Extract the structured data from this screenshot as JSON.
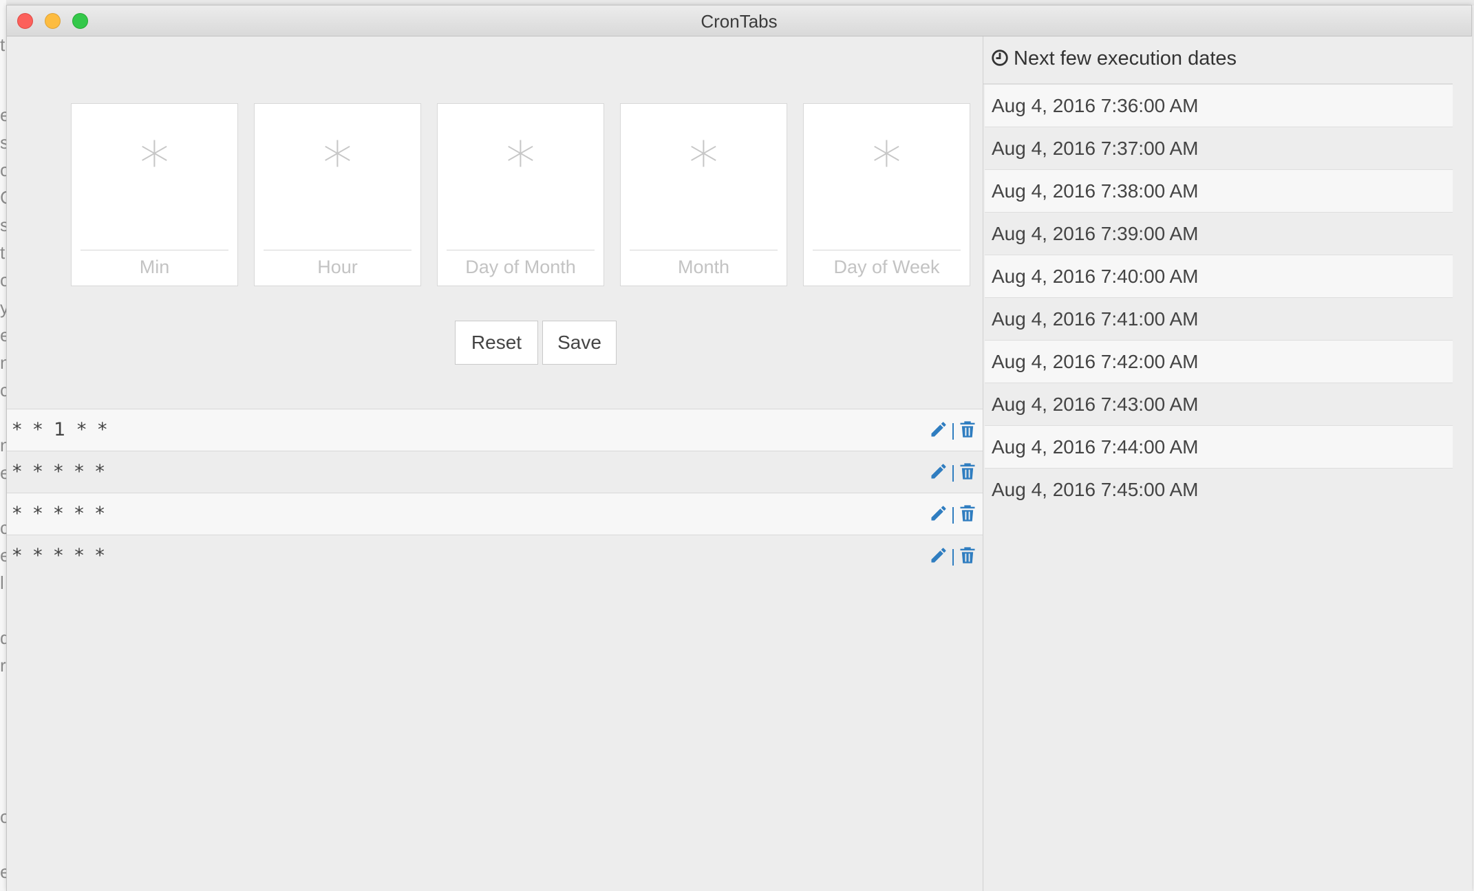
{
  "window": {
    "title": "CronTabs"
  },
  "editor": {
    "fields": [
      {
        "value": "*",
        "label": "Min"
      },
      {
        "value": "*",
        "label": "Hour"
      },
      {
        "value": "*",
        "label": "Day of Month"
      },
      {
        "value": "*",
        "label": "Month"
      },
      {
        "value": "*",
        "label": "Day of Week"
      }
    ],
    "reset_label": "Reset",
    "save_label": "Save"
  },
  "cron_list": [
    {
      "expression": "* * 1 * *"
    },
    {
      "expression": "* * * * *"
    },
    {
      "expression": "* * * * *"
    },
    {
      "expression": "* * * * *"
    }
  ],
  "next_dates": {
    "title": "Next few execution dates",
    "icon": "clock-icon",
    "dates": [
      "Aug 4, 2016 7:36:00 AM",
      "Aug 4, 2016 7:37:00 AM",
      "Aug 4, 2016 7:38:00 AM",
      "Aug 4, 2016 7:39:00 AM",
      "Aug 4, 2016 7:40:00 AM",
      "Aug 4, 2016 7:41:00 AM",
      "Aug 4, 2016 7:42:00 AM",
      "Aug 4, 2016 7:43:00 AM",
      "Aug 4, 2016 7:44:00 AM",
      "Aug 4, 2016 7:45:00 AM"
    ]
  },
  "background_app": {
    "visible_letters": [
      "t",
      "e",
      "s",
      "o",
      "C",
      "s",
      "t",
      "o",
      "y",
      "e",
      "n",
      "c",
      "n",
      "e",
      "c",
      "e",
      "l",
      "d",
      "r",
      "o",
      "e"
    ]
  },
  "colors": {
    "accent": "#2f7dc0",
    "close": "#fc605b",
    "minimize": "#fdbc40",
    "maximize": "#34c84a"
  }
}
